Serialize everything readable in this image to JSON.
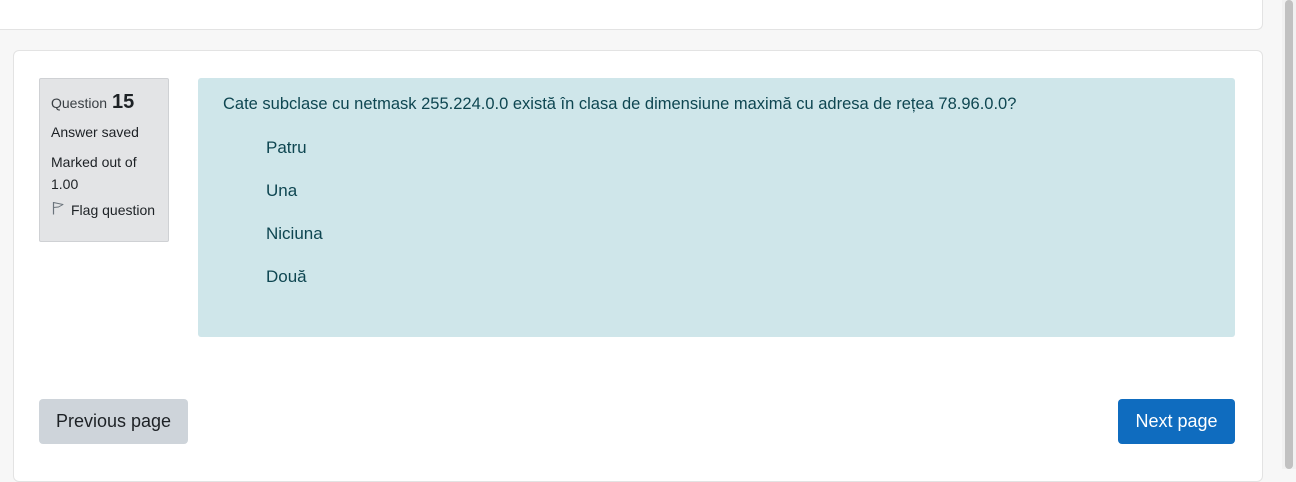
{
  "question": {
    "number_label": "Question",
    "number": "15",
    "state": "Answer saved",
    "grade": "Marked out of 1.00",
    "flag_label": "Flag question",
    "text": "Cate subclase cu netmask 255.224.0.0 există în clasa de dimensiune maximă cu adresa de rețea 78.96.0.0?",
    "answers": [
      "Patru",
      "Una",
      "Niciuna",
      "Două"
    ]
  },
  "navigation": {
    "previous_label": "Previous page",
    "next_label": "Next page"
  },
  "colors": {
    "content_bg": "#cfe6ea",
    "info_bg": "#e3e4e6",
    "next_button": "#0f6cbf",
    "previous_button": "#ced4da"
  }
}
